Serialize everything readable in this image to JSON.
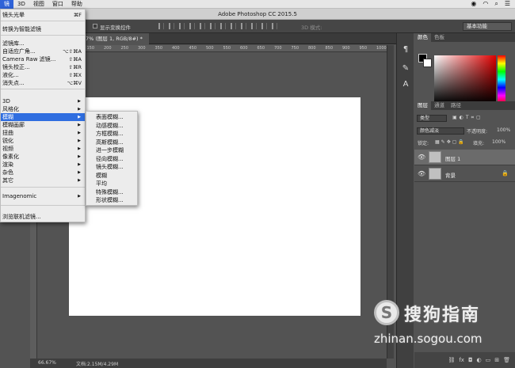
{
  "menubar": {
    "items": [
      {
        "label": "镜"
      },
      {
        "label": "3D"
      },
      {
        "label": "视图"
      },
      {
        "label": "窗口"
      },
      {
        "label": "帮助"
      }
    ],
    "status_icons": [
      "wechat-icon",
      "wifi-icon",
      "search-icon",
      "list-icon"
    ]
  },
  "window": {
    "title": "Adobe Photoshop CC 2015.5"
  },
  "options": {
    "show_transform_controls": "显示变换控件",
    "mode_3d": "3D 模式:",
    "workspace": "基本功能"
  },
  "document": {
    "tab_label": "7% (图层 1, RGB/8#) *",
    "zoom": "66.67%",
    "doc_size": "文档:2.15M/4.29M"
  },
  "ruler": {
    "ticks": [
      "100",
      "150",
      "200",
      "250",
      "300",
      "350",
      "400",
      "450",
      "500",
      "550",
      "600",
      "650",
      "700",
      "750",
      "800",
      "850",
      "900",
      "950",
      "1000"
    ]
  },
  "filter_menu": {
    "items": [
      {
        "label": "镜头光晕",
        "shortcut": "⌘F"
      },
      {
        "label": "转换为智能滤镜",
        "shortcut": ""
      },
      {
        "label": "滤镜库...",
        "shortcut": ""
      },
      {
        "label": "自适应广角...",
        "shortcut": "⌥⇧⌘A"
      },
      {
        "label": "Camera Raw 滤镜...",
        "shortcut": "⇧⌘A"
      },
      {
        "label": "镜头校正...",
        "shortcut": "⇧⌘R"
      },
      {
        "label": "液化...",
        "shortcut": "⇧⌘X"
      },
      {
        "label": "消失点...",
        "shortcut": "⌥⌘V"
      },
      {
        "label": "3D",
        "shortcut": ""
      },
      {
        "label": "风格化",
        "shortcut": ""
      },
      {
        "label": "模糊",
        "shortcut": ""
      },
      {
        "label": "模糊画廊",
        "shortcut": ""
      },
      {
        "label": "扭曲",
        "shortcut": ""
      },
      {
        "label": "锐化",
        "shortcut": ""
      },
      {
        "label": "视频",
        "shortcut": ""
      },
      {
        "label": "像素化",
        "shortcut": ""
      },
      {
        "label": "渲染",
        "shortcut": ""
      },
      {
        "label": "杂色",
        "shortcut": ""
      },
      {
        "label": "其它",
        "shortcut": ""
      },
      {
        "label": "Imagenomic",
        "shortcut": ""
      },
      {
        "label": "浏览联机滤镜...",
        "shortcut": ""
      }
    ]
  },
  "blur_menu": {
    "items": [
      {
        "label": "表面模糊..."
      },
      {
        "label": "动感模糊..."
      },
      {
        "label": "方框模糊..."
      },
      {
        "label": "高斯模糊..."
      },
      {
        "label": "进一步模糊"
      },
      {
        "label": "径向模糊..."
      },
      {
        "label": "镜头模糊..."
      },
      {
        "label": "模糊"
      },
      {
        "label": "平均"
      },
      {
        "label": "特殊模糊..."
      },
      {
        "label": "形状模糊..."
      }
    ]
  },
  "color_panel": {
    "tabs": [
      "颜色",
      "色板"
    ],
    "foreground": "#000000",
    "background": "#ffffff"
  },
  "layers_panel": {
    "tabs": [
      "图层",
      "通道",
      "路径"
    ],
    "filter_kind": "类型",
    "blend_mode": "颜色减淡",
    "opacity_label": "不透明度:",
    "opacity_value": "100%",
    "lock_label": "锁定:",
    "fill_label": "填充:",
    "fill_value": "100%",
    "layers": [
      {
        "name": "图层 1",
        "selected": true
      },
      {
        "name": "背景",
        "selected": false
      }
    ]
  },
  "watermark": {
    "name": "搜狗指南",
    "url": "zhinan.sogou.com"
  }
}
